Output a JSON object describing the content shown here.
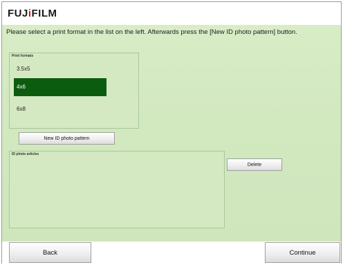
{
  "brand": {
    "logo_pre": "FUJ",
    "logo_dot": "i",
    "logo_post": "FILM"
  },
  "instruction": "Please select a print format in the list on the left. Afterwards press the [New ID photo pattern] button.",
  "formats": {
    "label": "Print formats",
    "items": [
      {
        "label": "3.5x5"
      },
      {
        "label": "4x6"
      },
      {
        "label": "6x8"
      }
    ],
    "selected": "4x6"
  },
  "new_id_button": "New ID photo pattern",
  "articles": {
    "label": "ID photo articles"
  },
  "delete_button": "Delete",
  "footer": {
    "back": "Back",
    "continue": "Continue"
  },
  "colors": {
    "selected": "#0c5c0f",
    "panel_bg": "#d4e9c2",
    "brand_red": "#d7111b"
  }
}
